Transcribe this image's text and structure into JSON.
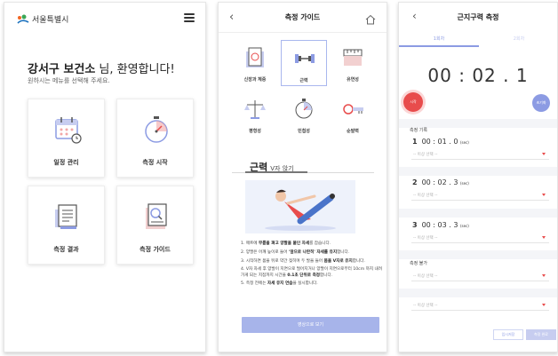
{
  "colors": {
    "accent": "#8c9be3",
    "danger": "#e84c4c",
    "brand_green": "#3aa757"
  },
  "home": {
    "logo_text": "서울특별시",
    "menu_icon": "hamburger-icon",
    "welcome_name": "강서구 보건소",
    "welcome_suffix": " 님, 환영합니다!",
    "subtitle": "원하시는 메뉴를 선택해 주세요.",
    "tiles": [
      {
        "label": "일정 관리",
        "icon": "calendar-icon"
      },
      {
        "label": "측정 시작",
        "icon": "stopwatch-icon"
      },
      {
        "label": "측정 결과",
        "icon": "results-clipboard-icon"
      },
      {
        "label": "측정 가이드",
        "icon": "guide-search-icon"
      }
    ]
  },
  "guide": {
    "back": "‹",
    "title": "측정 가이드",
    "categories": [
      {
        "label": "신장과 체중",
        "icon": "scale-height-icon"
      },
      {
        "label": "근력",
        "icon": "dumbbell-icon"
      },
      {
        "label": "유연성",
        "icon": "ruler-icon"
      },
      {
        "label": "평형성",
        "icon": "balance-icon"
      },
      {
        "label": "민첩성",
        "icon": "stopwatch-icon"
      },
      {
        "label": "순발력",
        "icon": "key-icon"
      }
    ],
    "section_title": "근력",
    "section_subtitle": "V자 앉기",
    "instructions": [
      {
        "pre": "1. 매트에 ",
        "b": "무릎을 펴고 양팔을 붙인 자세",
        "post": "를 잡습니다."
      },
      {
        "pre": "2. 양팔은 어깨 높이로 들어 ",
        "b": "'앞으로 나란히' 자세를 유지",
        "post": "합니다."
      },
      {
        "pre": "3. 시작하면 몸을 뒤로 약간 젖히며 두 발을 들어 ",
        "b": "몸을 V자로 유지",
        "post": "합니다."
      },
      {
        "pre": "4. V자 자세 후 양발이 지면으로 떨어지거나 양팔이 지면으로부터 10cm 까지 내려가게 되는 지점까지 시간을 ",
        "b": "0.1초 단위로 측정",
        "post": "합니다."
      },
      {
        "pre": "5. 측정 전에는 ",
        "b": "자세 유지 연습",
        "post": "을 실시합니다."
      }
    ],
    "video_button": "영상으로 보기"
  },
  "measure": {
    "back": "‹",
    "title": "근지구력 측정",
    "tabs": [
      "1회차",
      "2회차"
    ],
    "timer": "00 : 02 . 1",
    "start_button": "시작",
    "record_button": "초기화",
    "records_label": "측정 기록",
    "records": [
      {
        "num": "1",
        "time": "00 : 01 . 0",
        "unit": "(sec)",
        "placeholder": "-- 이상 선택 --"
      },
      {
        "num": "2",
        "time": "00 : 02 . 3",
        "unit": "(sec)",
        "placeholder": "-- 이상 선택 --"
      },
      {
        "num": "3",
        "time": "00 : 03 . 3",
        "unit": "(sec)",
        "placeholder": "-- 이상 선택 --"
      }
    ],
    "status_label": "측정 불가",
    "status_placeholders": [
      "-- 이상 선택 --",
      "-- 이상 선택 --"
    ],
    "save_button": "임시저장",
    "done_button": "측정 완료"
  }
}
